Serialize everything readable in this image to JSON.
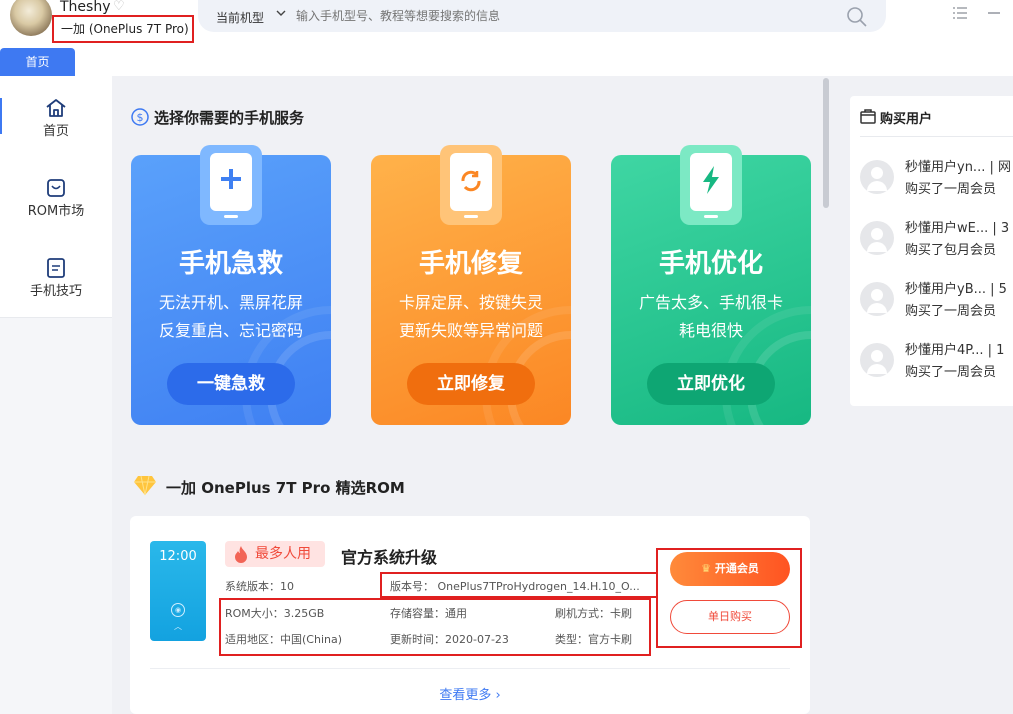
{
  "header": {
    "username": "Theshy",
    "device": "一加 (OnePlus 7T Pro)",
    "model_label": "当前机型",
    "search_placeholder": "输入手机型号、教程等想要搜索的信息"
  },
  "tabs": [
    {
      "label": "首页"
    }
  ],
  "sidebar": {
    "items": [
      {
        "label": "首页",
        "icon": "home-icon",
        "active": true
      },
      {
        "label": "ROM市场",
        "icon": "rom-market-icon"
      },
      {
        "label": "手机技巧",
        "icon": "tips-icon"
      }
    ]
  },
  "services": {
    "title": "选择你需要的手机服务",
    "cards": [
      {
        "title": "手机急救",
        "desc1": "无法开机、黑屏花屏",
        "desc2": "反复重启、忘记密码",
        "button": "一键急救",
        "color": "#4a8cf6",
        "icon": "plus-icon"
      },
      {
        "title": "手机修复",
        "desc1": "卡屏定屏、按键失灵",
        "desc2": "更新失败等异常问题",
        "button": "立即修复",
        "color": "#fb8f2f",
        "icon": "refresh-icon"
      },
      {
        "title": "手机优化",
        "desc1": "广告太多、手机很卡",
        "desc2": "耗电很快",
        "button": "立即优化",
        "color": "#23c38e",
        "icon": "lightning-icon"
      }
    ]
  },
  "rom": {
    "section_title": "一加 OnePlus 7T Pro 精选ROM",
    "thumb_time": "12:00",
    "badge": "最多人用",
    "title": "官方系统升级",
    "system_version": "系统版本：10",
    "build_number": "版本号：  OnePlus7TProHydrogen_14.H.10_O...",
    "rom_size": "ROM大小：3.25GB",
    "storage": "存储容量：通用",
    "flash_method": "刷机方式：卡刷",
    "region": "适用地区：中国(China)",
    "update_time": "更新时间：2020-07-23",
    "type": "类型：官方卡刷",
    "vip_button": "开通会员",
    "buy_button": "单日购买",
    "more": "查看更多"
  },
  "buyers": {
    "title": "购买用户",
    "items": [
      {
        "name": "秒懂用户yn...  | 网",
        "action": "购买了一周会员"
      },
      {
        "name": "秒懂用户wE...  | 3",
        "action": "购买了包月会员"
      },
      {
        "name": "秒懂用户yB...  | 5",
        "action": "购买了一周会员"
      },
      {
        "name": "秒懂用户4P...  | 1",
        "action": "购买了一周会员"
      }
    ]
  }
}
